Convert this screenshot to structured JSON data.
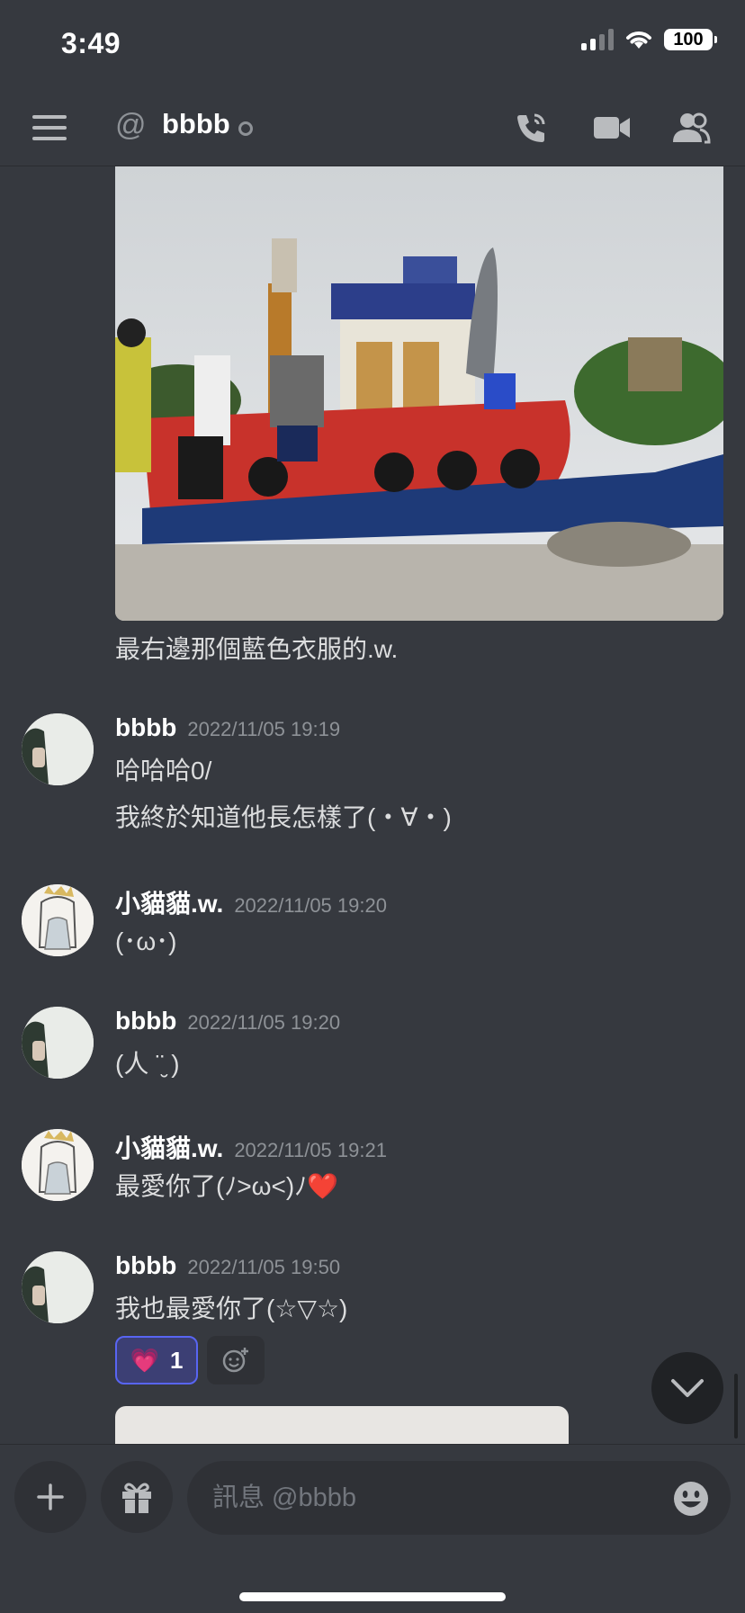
{
  "status_bar": {
    "time": "3:49",
    "battery": "100"
  },
  "header": {
    "channel_name": "bbbb"
  },
  "photo_caption": "最右邊那個藍色衣服的.w.",
  "messages": [
    {
      "username": "bbbb",
      "timestamp": "2022/11/05 19:19",
      "lines": [
        "哈哈哈0/",
        "我終於知道他長怎樣了(・∀・)"
      ]
    },
    {
      "username": "小貓貓.w.",
      "timestamp": "2022/11/05 19:20",
      "lines": [
        "(･ω･)"
      ]
    },
    {
      "username": "bbbb",
      "timestamp": "2022/11/05 19:20",
      "lines": [
        "(人 ¨̮ )"
      ]
    },
    {
      "username": "小貓貓.w.",
      "timestamp": "2022/11/05 19:21",
      "lines": [
        "最愛你了(ﾉ>ω<)ﾉ❤️"
      ]
    },
    {
      "username": "bbbb",
      "timestamp": "2022/11/05 19:50",
      "lines": [
        "我也最愛你了(☆▽☆)"
      ]
    }
  ],
  "reaction": {
    "emoji": "💗",
    "count": "1"
  },
  "composer": {
    "placeholder": "訊息 @bbbb"
  },
  "colors": {
    "background": "#36393f",
    "accent": "#5865f2",
    "input_bg": "#2f3136",
    "muted": "#8e9297"
  }
}
